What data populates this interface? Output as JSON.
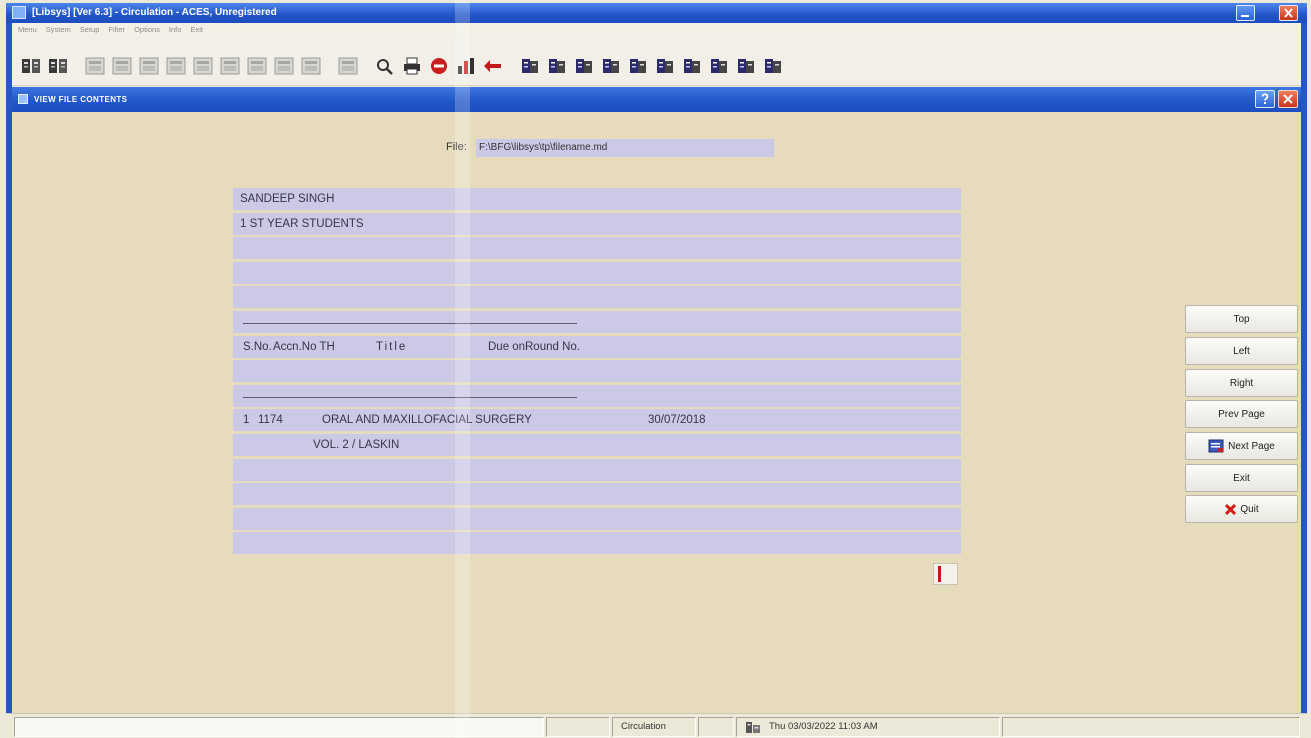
{
  "app": {
    "title": "[Libsys] [Ver 6.3] - Circulation - ACES, Unregistered",
    "menu": [
      "Menu",
      "System",
      "Setup",
      "Filter",
      "Options",
      "Info",
      "Exit"
    ]
  },
  "toolbar": {
    "groups": [
      [
        "member-issue-icon",
        "member-return-icon"
      ],
      [
        "report-icon",
        "list-icon",
        "form-icon",
        "table-icon",
        "calendar-icon",
        "document-icon",
        "notes-icon",
        "layout-icon",
        "window-icon"
      ],
      [
        "list-view-icon"
      ],
      [
        "search-icon",
        "print-icon",
        "stop-icon",
        "chart-icon",
        "arrow-icon"
      ],
      [
        "book-open-icon",
        "book-add-icon",
        "book-search-icon",
        "book-return-icon",
        "book-renew-icon",
        "book-reserve-icon",
        "book-transfer-icon",
        "book-fine-icon",
        "book-help-icon",
        "book-key-icon"
      ]
    ]
  },
  "dialog": {
    "title": "VIEW FILE CONTENTS",
    "file_label": "File:",
    "file_path": "F:\\BFG\\libsys\\tp\\filename.md"
  },
  "report": {
    "name": "SANDEEP SINGH",
    "group": "1 ST YEAR STUDENTS",
    "headers": {
      "sno": "S.No.",
      "accn": "Accn.No TH",
      "title": "Title",
      "due": "Due on",
      "round": "Round No."
    },
    "items": [
      {
        "sno": "1",
        "accn": "1174",
        "title": "ORAL AND MAXILLOFACIAL SURGERY",
        "due": "30/07/2018",
        "detail": "VOL. 2 / LASKIN"
      }
    ]
  },
  "buttons": {
    "top": "Top",
    "left": "Left",
    "right": "Right",
    "prev_page": "Prev Page",
    "next_page": "Next Page",
    "exit": "Exit",
    "quit": "Quit"
  },
  "status": {
    "module": "Circulation",
    "datetime": "Thu 03/03/2022 11:03 AM"
  },
  "colors": {
    "title_bar": "#2456c6",
    "content_bg": "#e7dbbe",
    "row_bg": "#cbc9e6",
    "cursor": "#c8141a"
  }
}
